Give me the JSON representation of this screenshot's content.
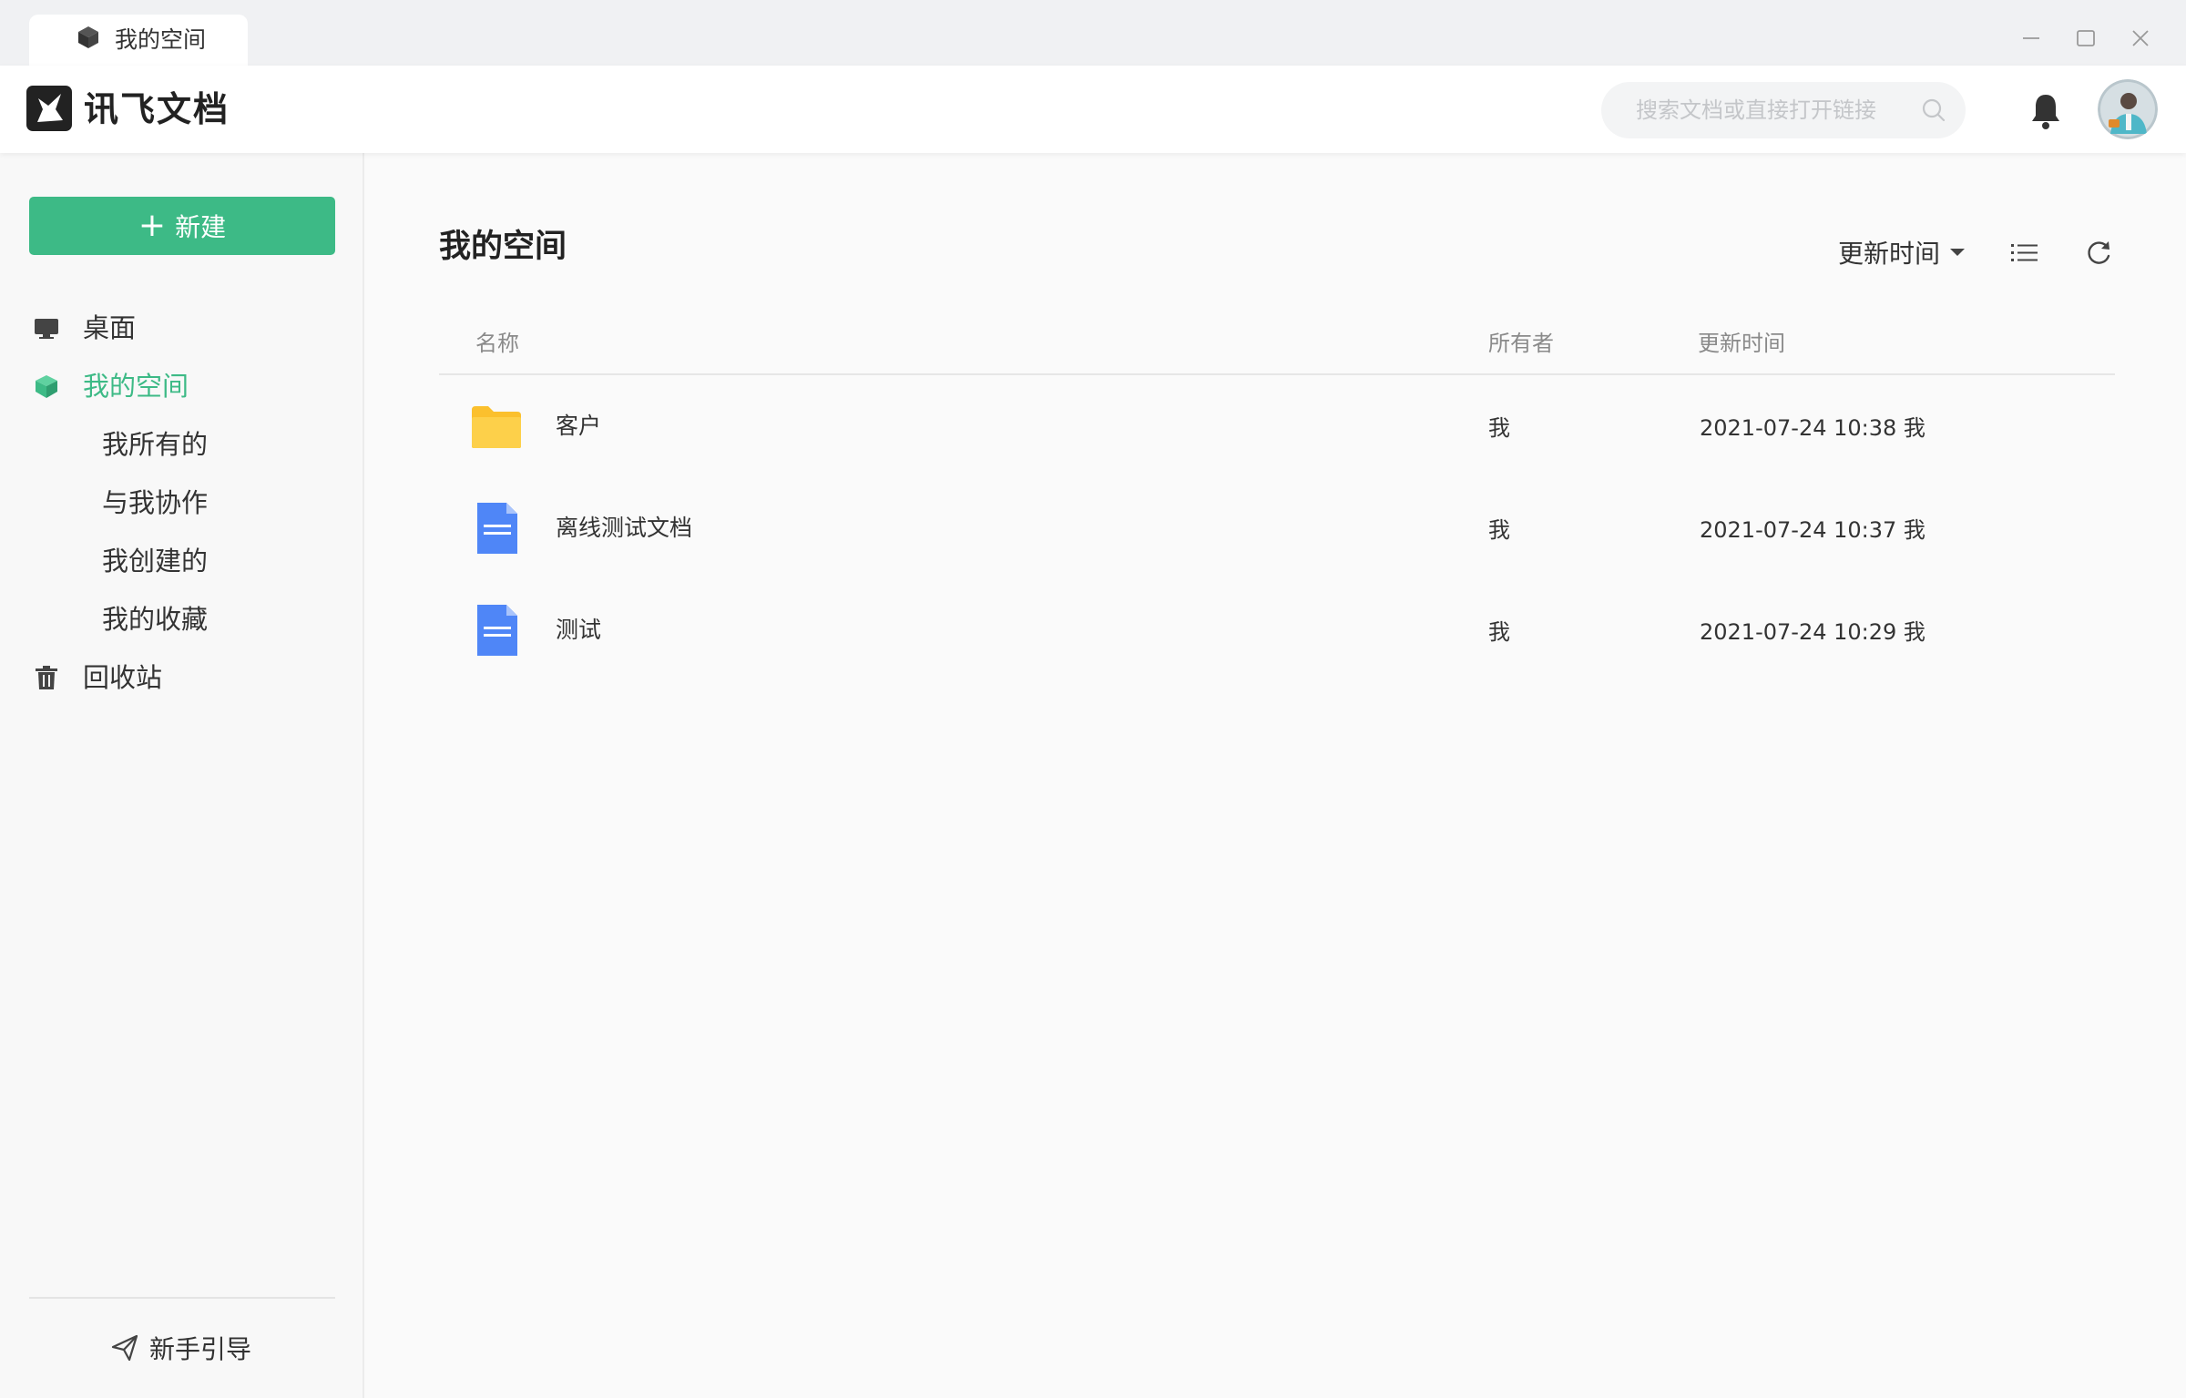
{
  "tab": {
    "label": "我的空间"
  },
  "header": {
    "app_title": "讯飞文档",
    "search_placeholder": "搜索文档或直接打开链接"
  },
  "sidebar": {
    "new_button_label": "新建",
    "items": [
      {
        "label": "桌面"
      },
      {
        "label": "我的空间"
      },
      {
        "label": "我所有的"
      },
      {
        "label": "与我协作"
      },
      {
        "label": "我创建的"
      },
      {
        "label": "我的收藏"
      },
      {
        "label": "回收站"
      }
    ],
    "guide_label": "新手引导"
  },
  "main": {
    "title": "我的空间",
    "sort_label": "更新时间",
    "columns": {
      "name": "名称",
      "owner": "所有者",
      "updated": "更新时间"
    },
    "rows": [
      {
        "type": "folder",
        "name": "客户",
        "owner": "我",
        "updated": "2021-07-24 10:38 我"
      },
      {
        "type": "doc",
        "name": "离线测试文档",
        "owner": "我",
        "updated": "2021-07-24 10:37 我"
      },
      {
        "type": "doc",
        "name": "测试",
        "owner": "我",
        "updated": "2021-07-24 10:29 我"
      }
    ]
  },
  "colors": {
    "accent": "#3dba86",
    "folder": "#fbc02d",
    "doc": "#4f86f7"
  }
}
